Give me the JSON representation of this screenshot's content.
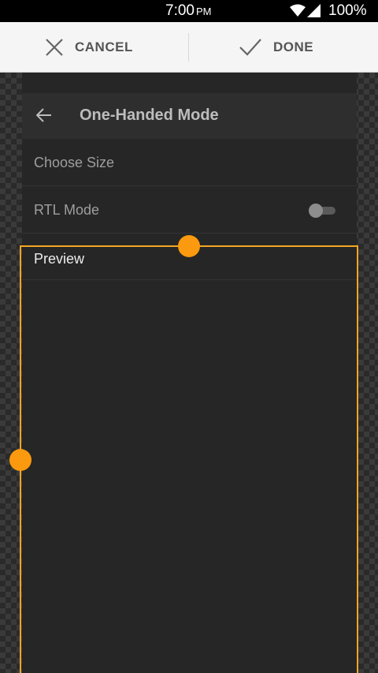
{
  "status_bar": {
    "time": "7:00",
    "ampm": "PM",
    "battery": "100%",
    "icons": [
      "wifi-icon",
      "signal-icon"
    ]
  },
  "action_bar": {
    "cancel_label": "CANCEL",
    "done_label": "DONE",
    "icons": [
      "close-icon",
      "check-icon"
    ]
  },
  "panel": {
    "title": "One-Handed Mode",
    "back_icon": "arrow-left-icon",
    "rows": [
      {
        "label": "Choose Size"
      },
      {
        "label": "RTL Mode",
        "toggle": "off"
      }
    ],
    "preview_label": "Preview"
  },
  "colors": {
    "accent": "#fb9a0e",
    "panel_bg": "#262626",
    "action_bar_bg": "#f5f5f5"
  }
}
